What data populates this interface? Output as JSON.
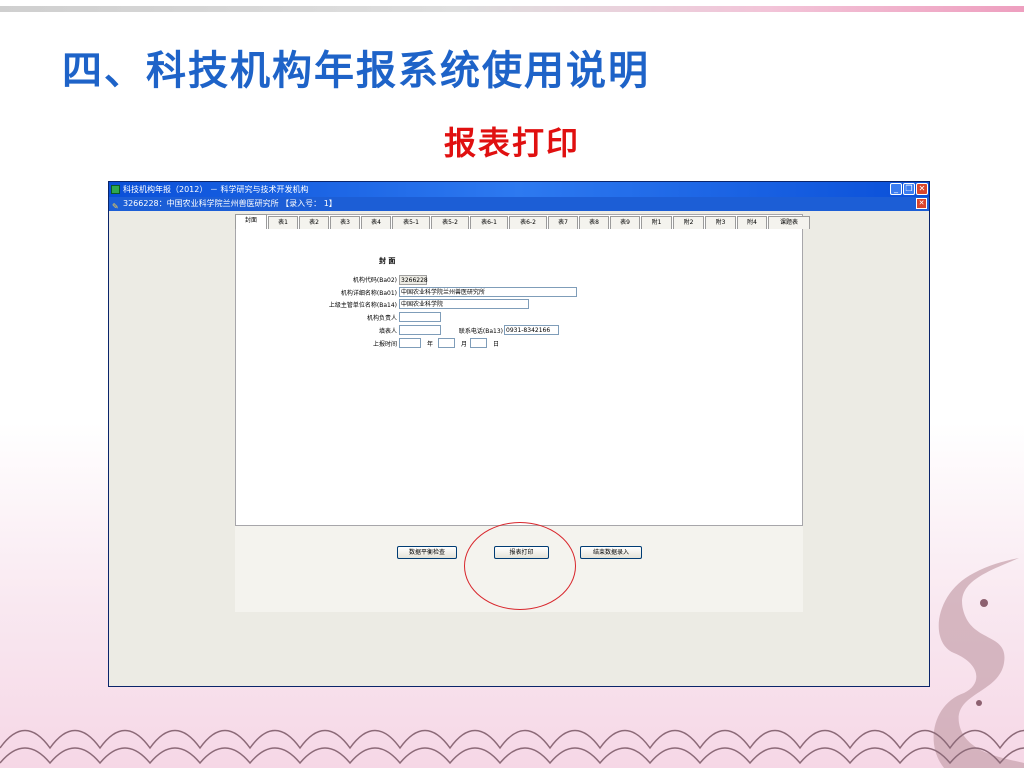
{
  "slide": {
    "title": "四、科技机构年报系统使用说明",
    "subtitle": "报表打印"
  },
  "window": {
    "title": "科技机构年报（2012） － 科学研究与技术开发机构",
    "subtitle": "3266228：中国农业科学院兰州兽医研究所 【录入号：   1】",
    "buttons": {
      "minimize": "_",
      "restore": "❐",
      "close": "✕"
    }
  },
  "tabs": [
    "封面",
    "表1",
    "表2",
    "表3",
    "表4",
    "表5-1",
    "表5-2",
    "表6-1",
    "表6-2",
    "表7",
    "表8",
    "表9",
    "附1",
    "附2",
    "附3",
    "附4",
    "课题表"
  ],
  "form": {
    "title": "封    面",
    "org_code": {
      "label": "机构代码(Ba02)",
      "value": "3266228"
    },
    "org_name": {
      "label": "机构详细名称(Ba01)",
      "value": "中国农业科学院兰州兽医研究所"
    },
    "superior": {
      "label": "上级主管单位名称(Ba14)",
      "value": "中国农业科学院"
    },
    "head": {
      "label": "机构负责人",
      "value": ""
    },
    "filler": {
      "label": "填表人",
      "value": ""
    },
    "phone": {
      "label": "联系电话(Ba13)",
      "value": "0931-8342166"
    },
    "report_date": {
      "label": "上报时间",
      "year_label": "年",
      "month_label": "月",
      "day_label": "日"
    }
  },
  "actions": {
    "check": "数据平衡检查",
    "print": "报表打印",
    "finish": "结束数据录入"
  },
  "colors": {
    "title_blue": "#1e63c8",
    "subtitle_red": "#e01010",
    "highlight_circle": "#d8262c"
  }
}
